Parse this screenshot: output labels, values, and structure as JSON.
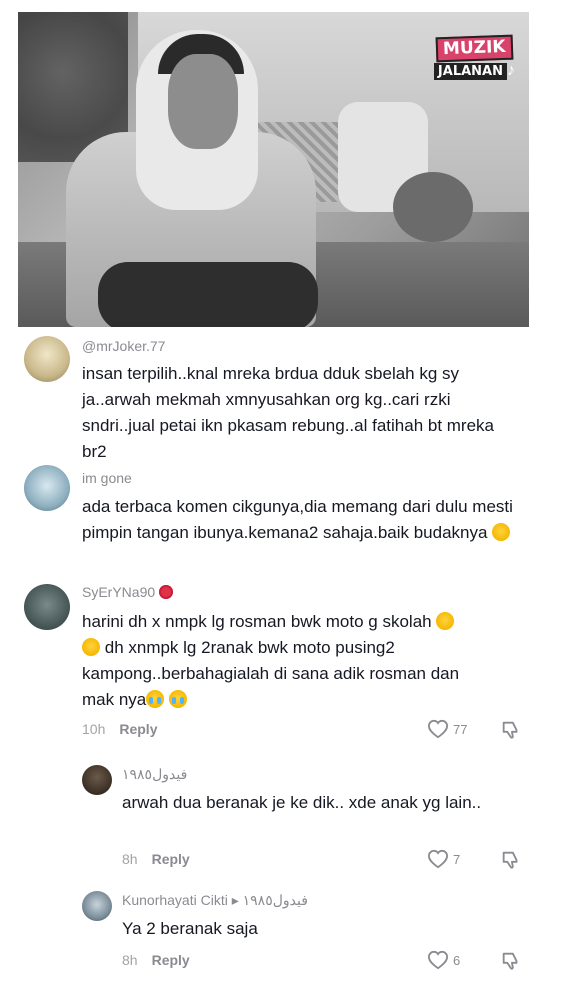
{
  "hero": {
    "logo_line1": "MUZIK",
    "logo_line2": "JALANAN"
  },
  "comments": [
    {
      "username": "@mrJoker.77",
      "text": "insan terpilih..knal mreka brdua dduk sbelah kg sy ja..arwah mekmah xmnyusahkan org kg..cari rzki sndri..jual petai ikn pkasam rebung..al fatihah bt mreka br2"
    },
    {
      "username": "im gone",
      "text": "ada terbaca komen cikgunya,dia memang dari dulu mesti pimpin tangan ibunya.kemana2 sahaja.baik budaknya"
    },
    {
      "username": "SyErYNa90",
      "text_line1": "harini dh x nmpk lg rosman bwk moto g skolah",
      "text_line2": "dh xnmpk lg 2ranak bwk moto pusing2",
      "text_line3": "kampong..berbahagialah di sana adik rosman dan",
      "text_line4": "mak nya",
      "time": "10h",
      "reply": "Reply",
      "likes": "77"
    }
  ],
  "replies": [
    {
      "username": "فيدول١٩٨٥",
      "text": "arwah dua beranak je ke dik.. xde anak yg lain..",
      "time": "8h",
      "reply": "Reply",
      "likes": "7"
    },
    {
      "username": "Kunorhayati Cikti",
      "arrow": "▸",
      "reply_to": "فيدول١٩٨٥",
      "text": "Ya 2 beranak saja",
      "time": "8h",
      "reply": "Reply",
      "likes": "6"
    }
  ],
  "icons": {
    "like": "heart-outline-icon",
    "dislike": "thumbs-down-icon"
  },
  "colors": {
    "text": "#161823",
    "secondary": "#8a8b91",
    "logo_pink": "#d9436b"
  }
}
